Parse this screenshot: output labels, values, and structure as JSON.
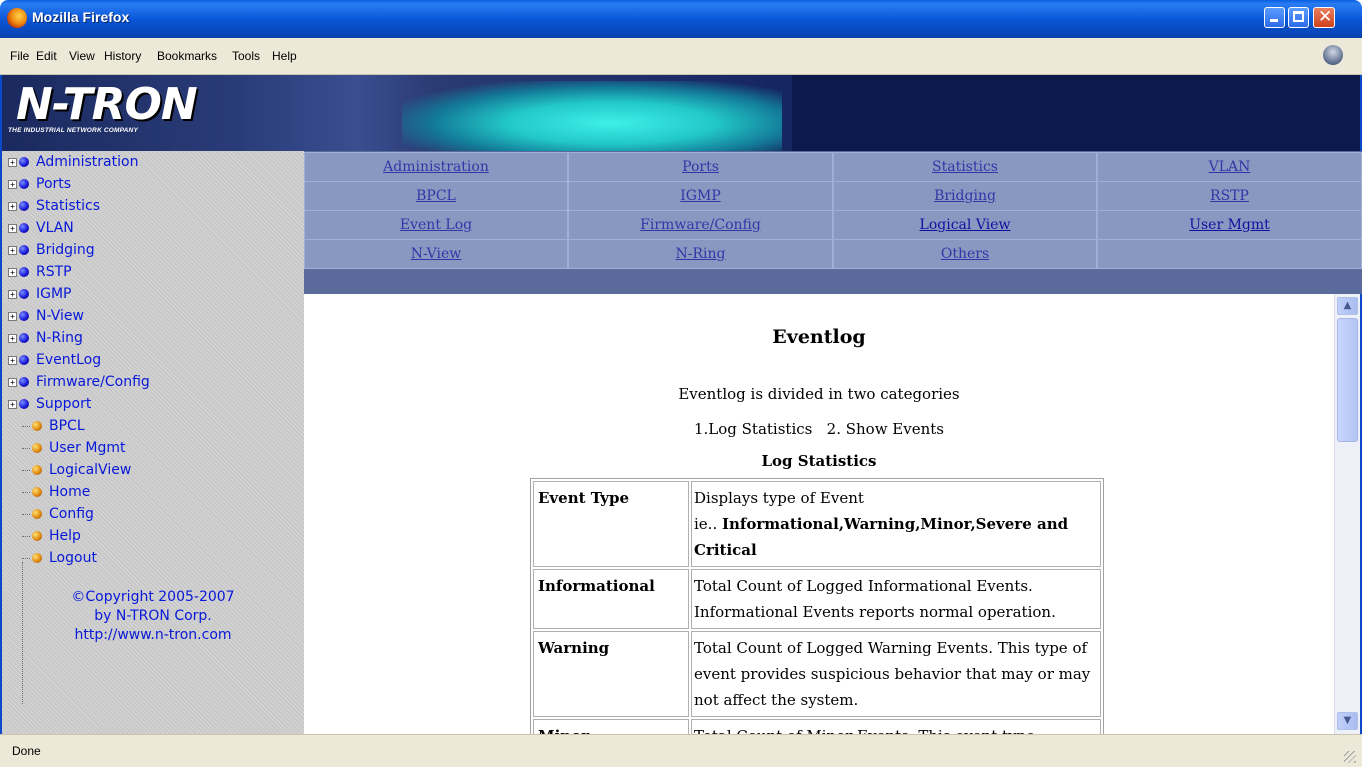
{
  "window": {
    "title": "Mozilla Firefox",
    "minimize_icon": "minimize-icon",
    "maximize_icon": "maximize-icon",
    "close_icon": "close-icon",
    "close_glyph": "✕"
  },
  "menu": {
    "items": [
      "File",
      "Edit",
      "View",
      "History",
      "Bookmarks",
      "Tools",
      "Help"
    ]
  },
  "banner": {
    "logo": "N-TRON",
    "tagline": "THE INDUSTRIAL NETWORK COMPANY"
  },
  "sidebar": {
    "tree_items": [
      {
        "label": "Administration",
        "icon": "blue-ball-icon",
        "expandable": true
      },
      {
        "label": "Ports",
        "icon": "blue-ball-icon",
        "expandable": true
      },
      {
        "label": "Statistics",
        "icon": "blue-ball-icon",
        "expandable": true
      },
      {
        "label": "VLAN",
        "icon": "blue-ball-icon",
        "expandable": true
      },
      {
        "label": "Bridging",
        "icon": "blue-ball-icon",
        "expandable": true
      },
      {
        "label": "RSTP",
        "icon": "blue-ball-icon",
        "expandable": true
      },
      {
        "label": "IGMP",
        "icon": "blue-ball-icon",
        "expandable": true
      },
      {
        "label": "N-View",
        "icon": "blue-ball-icon",
        "expandable": true
      },
      {
        "label": "N-Ring",
        "icon": "blue-ball-icon",
        "expandable": true
      },
      {
        "label": "EventLog",
        "icon": "blue-ball-icon",
        "expandable": true
      },
      {
        "label": "Firmware/Config",
        "icon": "blue-ball-icon",
        "expandable": true
      },
      {
        "label": "Support",
        "icon": "blue-ball-icon",
        "expandable": true
      },
      {
        "label": "BPCL",
        "icon": "orange-ball-icon",
        "expandable": false
      },
      {
        "label": "User Mgmt",
        "icon": "orange-ball-icon",
        "expandable": false
      },
      {
        "label": "LogicalView",
        "icon": "orange-ball-icon",
        "expandable": false
      },
      {
        "label": "Home",
        "icon": "orange-ball-icon",
        "expandable": false
      },
      {
        "label": "Config",
        "icon": "orange-ball-icon",
        "expandable": false
      },
      {
        "label": "Help",
        "icon": "orange-ball-icon",
        "expandable": false
      },
      {
        "label": "Logout",
        "icon": "orange-ball-icon",
        "expandable": false
      }
    ],
    "expand_glyph": "+",
    "copyright_line1": "©Copyright 2005-2007",
    "copyright_line2": "by N-TRON Corp.",
    "copyright_line3": "http://www.n-tron.com"
  },
  "nav": {
    "rows": [
      [
        "Administration",
        "Ports",
        "Statistics",
        "VLAN"
      ],
      [
        "BPCL",
        "IGMP",
        "Bridging",
        "RSTP"
      ],
      [
        "Event Log",
        "Firmware/Config",
        "Logical View",
        "User Mgmt"
      ],
      [
        "N-View",
        "N-Ring",
        "Others",
        ""
      ]
    ]
  },
  "content": {
    "heading": "Eventlog",
    "intro": "Eventlog is divided in two categories",
    "categories": "1.Log Statistics   2. Show Events",
    "section_title": "Log Statistics",
    "table": [
      {
        "key": "Event Type",
        "desc": "Displays type of Event",
        "desc2_prefix": "ie.. ",
        "desc2_bold": "Informational,Warning,Minor,Severe and Critical"
      },
      {
        "key": "Informational",
        "desc": "Total Count of Logged Informational Events. Informational Events reports normal operation."
      },
      {
        "key": "Warning",
        "desc": "Total Count of Logged Warning Events. This type of event provides suspicious behavior that may or may not affect the system."
      },
      {
        "key": "Minor",
        "desc": "Total Count of Minor Events. This event type"
      }
    ]
  },
  "scrollbar": {
    "up_glyph": "▲",
    "down_glyph": "▼"
  },
  "status": {
    "text": "Done"
  },
  "colors": {
    "titlebar": "#0a57d8",
    "link": "#0818d8",
    "nav_cell": "#8898c0",
    "nav_bg": "#5a6a9a"
  }
}
